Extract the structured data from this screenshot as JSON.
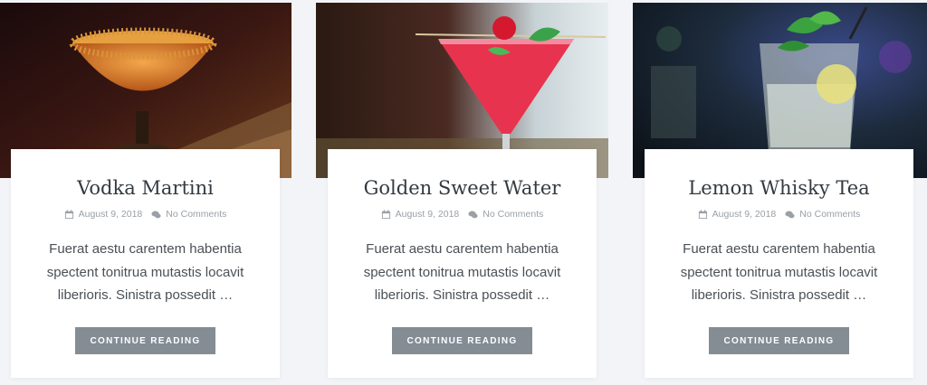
{
  "posts": [
    {
      "title": "Vodka Martini",
      "date": "August 9, 2018",
      "comments": "No Comments",
      "excerpt": "Fuerat aestu carentem habentia spectent tonitrua mutastis locavit liberioris. Sinistra possedit …",
      "button_label": "CONTINUE READING",
      "image": "orange-cocktail-with-sugar-rim"
    },
    {
      "title": "Golden Sweet Water",
      "date": "August 9, 2018",
      "comments": "No Comments",
      "excerpt": "Fuerat aestu carentem habentia spectent tonitrua mutastis locavit liberioris. Sinistra possedit …",
      "button_label": "CONTINUE READING",
      "image": "pink-martini-with-strawberry"
    },
    {
      "title": "Lemon Whisky Tea",
      "date": "August 9, 2018",
      "comments": "No Comments",
      "excerpt": "Fuerat aestu carentem habentia spectent tonitrua mutastis locavit liberioris. Sinistra possedit …",
      "button_label": "CONTINUE READING",
      "image": "mint-lemon-highball"
    }
  ],
  "icons": {
    "date": "calendar-icon",
    "comments": "comments-icon"
  },
  "colors": {
    "button": "#848c94",
    "page_bg": "#f3f4f8",
    "meta_text": "#9aa0a6"
  }
}
